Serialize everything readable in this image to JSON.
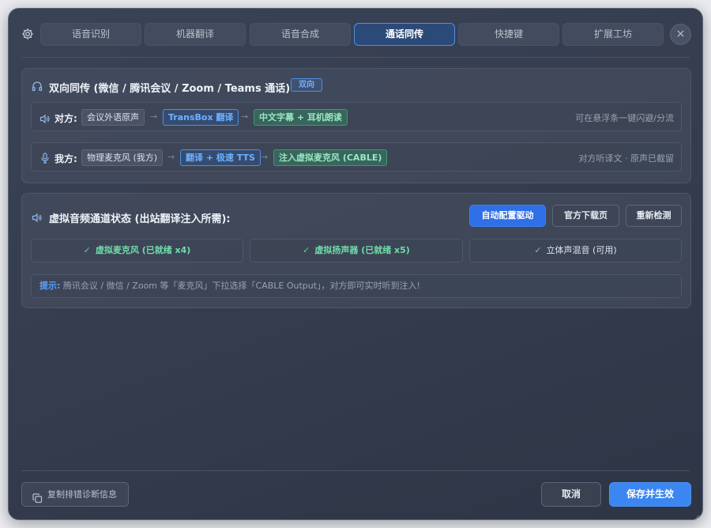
{
  "tabs": [
    {
      "label": "语音识别"
    },
    {
      "label": "机器翻译"
    },
    {
      "label": "语音合成"
    },
    {
      "label": "通话同传",
      "active": true
    },
    {
      "label": "快捷键"
    },
    {
      "label": "扩展工坊"
    }
  ],
  "close_label": "×",
  "bidirectional": {
    "title": "双向同传 (微信 / 腾讯会议 / Zoom / Teams 通话)",
    "badge": "双向",
    "rows": [
      {
        "label": "对方:",
        "source": "会议外语原声",
        "step1": "TransBox 翻译",
        "step2": "中文字幕 + 耳机朗读",
        "note": "可在悬浮条一键闪避/分流"
      },
      {
        "label": "我方:",
        "source": "物理麦克风 (我方)",
        "step1": "翻译 + 极速 TTS",
        "step2": "注入虚拟麦克风 (CABLE)",
        "note": "对方听译文 · 原声已截留"
      }
    ],
    "arrow": "→"
  },
  "virtual": {
    "title": "虚拟音频通道状态 (出站翻译注入所需):",
    "buttons": {
      "auto": "自动配置驱动",
      "download": "官方下载页",
      "recheck": "重新检测"
    },
    "status": [
      {
        "label": "虚拟麦克风 (已就绪 x4)"
      },
      {
        "label": "虚拟扬声器 (已就绪 x5)"
      },
      {
        "label": "立体声混音 (可用)"
      }
    ],
    "check": "✓",
    "tip_label": "提示:",
    "tip_text": "腾讯会议 / 微信 / Zoom 等「麦克风」下拉选择「CABLE Output」，对方即可实时听到注入!"
  },
  "footer": {
    "diag": "复制排错诊断信息",
    "cancel": "取消",
    "save": "保存并生效"
  },
  "colors": {
    "accent": "#3b86f0",
    "success": "#6fdcaa",
    "panel": "#3a4356"
  }
}
